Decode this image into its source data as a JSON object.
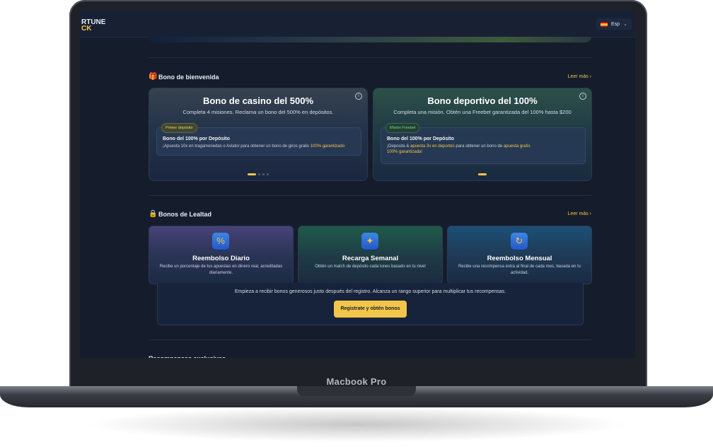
{
  "device": {
    "label": "Macbook Pro"
  },
  "header": {
    "logo_line1": "RTUNE",
    "logo_line2": "CK",
    "language": "Esp"
  },
  "welcome": {
    "title": "Bono de bienvenida",
    "more": "Leer más",
    "cards": [
      {
        "title": "Bono de casino del 500%",
        "subtitle": "Completa 4 misiones. Reclama un bono del 500% en depósitos.",
        "badge": "Primer depósito",
        "mission_title": "Bono del 100% por Depósito",
        "mission_desc_pre": "¡Apuesta 10x en tragamonedas o Aviator para obtener un bono de giros gratis ",
        "mission_desc_hl": "100% garantizado"
      },
      {
        "title": "Bono deportivo del 100%",
        "subtitle": "Completa una misión. Obtén una Freebet garantizada del 100% hasta $200",
        "badge": "Misión Freebet",
        "mission_title": "Bono del 100% por Depósito",
        "mission_desc_a": "¡Deposita & ",
        "mission_desc_hl1": "apuesta 3x en deportes",
        "mission_desc_b": " para obtener un bono de ",
        "mission_desc_hl2": "apuesta gratis",
        "mission_desc_line2": "100% garantizada!"
      }
    ]
  },
  "loyalty": {
    "title": "Bonos de Lealtad",
    "more": "Leer más",
    "items": [
      {
        "title": "Reembolso Diario",
        "desc": "Recibe un porcentaje de tus apuestas en dinero real, acreditadas diariamente.",
        "icon": "calendar-percent-icon"
      },
      {
        "title": "Recarga Semanal",
        "desc": "Obtén un match de depósito cada lunes basado en tu nivel",
        "icon": "gift-icon"
      },
      {
        "title": "Reembolso Mensual",
        "desc": "Recibe una recompensa extra al final de cada mes, basada en tu actividad.",
        "icon": "calendar-refresh-icon"
      }
    ],
    "promo_text": "Empieza a recibir bonos generosos justo después del registro. Alcanza un rango superior para multiplicar tus recompensas.",
    "cta": "Registrate y obtén bonos"
  },
  "next_section_partial": "Recompensas exclusivas"
}
